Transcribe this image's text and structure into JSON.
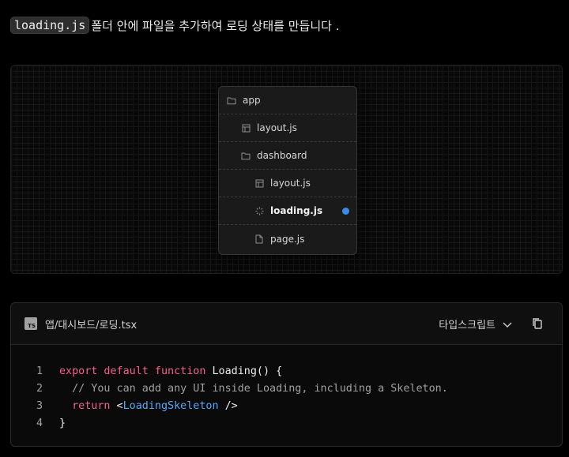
{
  "intro": {
    "code": "loading.js",
    "text": "폴더 안에 파일을 추가하여 로딩 상태를 만듭니다 ."
  },
  "file_tree": {
    "rows": [
      {
        "label": "app",
        "icon": "folder-icon"
      },
      {
        "label": "layout.js",
        "icon": "layout-icon"
      },
      {
        "label": "dashboard",
        "icon": "folder-icon"
      },
      {
        "label": "layout.js",
        "icon": "layout-icon"
      },
      {
        "label": "loading.js",
        "icon": "loading-spinner-icon",
        "highlight": true,
        "dot_color": "#3b8be6"
      },
      {
        "label": "page.js",
        "icon": "file-icon"
      }
    ]
  },
  "code_block": {
    "badge": "TS",
    "filename": "앱/대시보드/로딩.tsx",
    "language": "타입스크립트",
    "lines": [
      {
        "num": "1",
        "p1": "export default function",
        "p2": " Loading() {"
      },
      {
        "num": "2",
        "comment": "  // You can add any UI inside Loading, including a Skeleton."
      },
      {
        "num": "3",
        "p1": "  return",
        "p2": " <",
        "tag": "LoadingSkeleton",
        "p3": " />"
      },
      {
        "num": "4",
        "p2": "}"
      }
    ]
  },
  "colors": {
    "keyword": "#f75f8f",
    "comment": "#a1a1a1",
    "component": "#52a8ff",
    "accent_dot": "#3b8be6"
  }
}
